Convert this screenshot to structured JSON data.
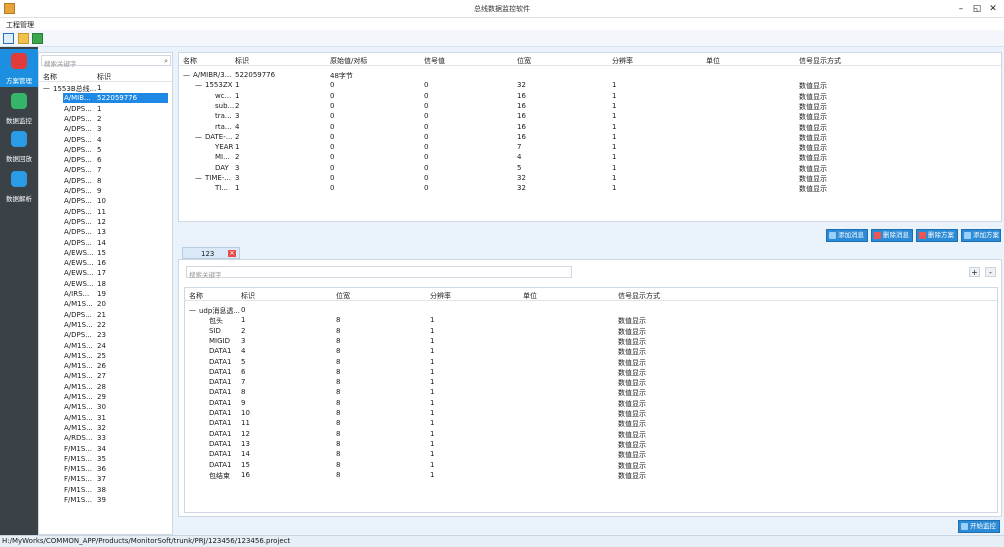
{
  "window": {
    "title": "总线数据监控软件",
    "min": "–",
    "restore": "◱",
    "close": "✕"
  },
  "menu": {
    "project": "工程管理"
  },
  "toolbar": {
    "icons": [
      "new-icon",
      "open-icon",
      "save-icon"
    ]
  },
  "nav": [
    {
      "label": "方案管理",
      "icon": "scheme-icon",
      "color": "#e23b3b"
    },
    {
      "label": "数据监控",
      "icon": "shield-icon",
      "color": "#35b56a"
    },
    {
      "label": "数据回放",
      "icon": "cloud-icon",
      "color": "#2a9be6"
    },
    {
      "label": "数据解析",
      "icon": "board-icon",
      "color": "#2a9be6"
    }
  ],
  "tree": {
    "search_placeholder": "搜索关键字",
    "col_name": "名称",
    "col_id": "标识",
    "root": {
      "toggle": "—",
      "name": "1553B总线...",
      "id": "1"
    },
    "selected": {
      "name": "A/MIB...",
      "id": "522059776"
    },
    "items": [
      {
        "name": "A/DPS...",
        "id": "1"
      },
      {
        "name": "A/DPS...",
        "id": "2"
      },
      {
        "name": "A/DPS...",
        "id": "3"
      },
      {
        "name": "A/DPS...",
        "id": "4"
      },
      {
        "name": "A/DPS...",
        "id": "5"
      },
      {
        "name": "A/DPS...",
        "id": "6"
      },
      {
        "name": "A/DPS...",
        "id": "7"
      },
      {
        "name": "A/DPS...",
        "id": "8"
      },
      {
        "name": "A/DPS...",
        "id": "9"
      },
      {
        "name": "A/DPS...",
        "id": "10"
      },
      {
        "name": "A/DPS...",
        "id": "11"
      },
      {
        "name": "A/DPS...",
        "id": "12"
      },
      {
        "name": "A/DPS...",
        "id": "13"
      },
      {
        "name": "A/DPS...",
        "id": "14"
      },
      {
        "name": "A/EWS...",
        "id": "15"
      },
      {
        "name": "A/EWS...",
        "id": "16"
      },
      {
        "name": "A/EWS...",
        "id": "17"
      },
      {
        "name": "A/EWS...",
        "id": "18"
      },
      {
        "name": "A/IRS...",
        "id": "19"
      },
      {
        "name": "A/M1S...",
        "id": "20"
      },
      {
        "name": "A/DPS...",
        "id": "21"
      },
      {
        "name": "A/M1S...",
        "id": "22"
      },
      {
        "name": "A/DPS...",
        "id": "23"
      },
      {
        "name": "A/M1S...",
        "id": "24"
      },
      {
        "name": "A/M1S...",
        "id": "25"
      },
      {
        "name": "A/M1S...",
        "id": "26"
      },
      {
        "name": "A/M1S...",
        "id": "27"
      },
      {
        "name": "A/M1S...",
        "id": "28"
      },
      {
        "name": "A/M1S...",
        "id": "29"
      },
      {
        "name": "A/M1S...",
        "id": "30"
      },
      {
        "name": "A/M1S...",
        "id": "31"
      },
      {
        "name": "A/M1S...",
        "id": "32"
      },
      {
        "name": "A/RDS...",
        "id": "33"
      },
      {
        "name": "F/M1S...",
        "id": "34"
      },
      {
        "name": "F/M1S...",
        "id": "35"
      },
      {
        "name": "F/M1S...",
        "id": "36"
      },
      {
        "name": "F/M1S...",
        "id": "37"
      },
      {
        "name": "F/M1S...",
        "id": "38"
      },
      {
        "name": "F/M1S...",
        "id": "39"
      }
    ]
  },
  "top_table": {
    "headers": [
      "名称",
      "标识",
      "原始值/对标",
      "信号值",
      "位宽",
      "分辨率",
      "单位",
      "信号显示方式"
    ],
    "rows": [
      {
        "t": "—",
        "n": "A/MIBR/3...",
        "id": "522059776",
        "raw": "48字节",
        "sig": "",
        "w": "",
        "r": "",
        "u": "",
        "d": "",
        "lvl": 0
      },
      {
        "t": "—",
        "n": "1553ZX",
        "id": "1",
        "raw": "0",
        "sig": "0",
        "w": "32",
        "r": "1",
        "u": "",
        "d": "数值显示",
        "lvl": 1
      },
      {
        "t": "",
        "n": "wc...",
        "id": "1",
        "raw": "0",
        "sig": "0",
        "w": "16",
        "r": "1",
        "u": "",
        "d": "数值显示",
        "lvl": 2
      },
      {
        "t": "",
        "n": "sub...",
        "id": "2",
        "raw": "0",
        "sig": "0",
        "w": "16",
        "r": "1",
        "u": "",
        "d": "数值显示",
        "lvl": 2
      },
      {
        "t": "",
        "n": "tra...",
        "id": "3",
        "raw": "0",
        "sig": "0",
        "w": "16",
        "r": "1",
        "u": "",
        "d": "数值显示",
        "lvl": 2
      },
      {
        "t": "",
        "n": "rta...",
        "id": "4",
        "raw": "0",
        "sig": "0",
        "w": "16",
        "r": "1",
        "u": "",
        "d": "数值显示",
        "lvl": 2
      },
      {
        "t": "—",
        "n": "DATE-...",
        "id": "2",
        "raw": "0",
        "sig": "0",
        "w": "16",
        "r": "1",
        "u": "",
        "d": "数值显示",
        "lvl": 1
      },
      {
        "t": "",
        "n": "YEAR",
        "id": "1",
        "raw": "0",
        "sig": "0",
        "w": "7",
        "r": "1",
        "u": "",
        "d": "数值显示",
        "lvl": 2
      },
      {
        "t": "",
        "n": "MI...",
        "id": "2",
        "raw": "0",
        "sig": "0",
        "w": "4",
        "r": "1",
        "u": "",
        "d": "数值显示",
        "lvl": 2
      },
      {
        "t": "",
        "n": "DAY",
        "id": "3",
        "raw": "0",
        "sig": "0",
        "w": "5",
        "r": "1",
        "u": "",
        "d": "数值显示",
        "lvl": 2
      },
      {
        "t": "—",
        "n": "TIME-...",
        "id": "3",
        "raw": "0",
        "sig": "0",
        "w": "32",
        "r": "1",
        "u": "",
        "d": "数值显示",
        "lvl": 1
      },
      {
        "t": "",
        "n": "TI...",
        "id": "1",
        "raw": "0",
        "sig": "0",
        "w": "32",
        "r": "1",
        "u": "",
        "d": "数值显示",
        "lvl": 2
      }
    ]
  },
  "buttons": {
    "add_msg": "添加消息",
    "del_msg": "删除消息",
    "del_scheme": "删除方案",
    "add_scheme": "添加方案",
    "start": "开始监控"
  },
  "tab": {
    "label": "123",
    "close": "✕"
  },
  "bottom": {
    "search_placeholder": "搜索关键字",
    "plus": "+",
    "minus": "-",
    "headers": [
      "名称",
      "标识",
      "位宽",
      "分辨率",
      "单位",
      "信号显示方式"
    ],
    "rows": [
      {
        "t": "—",
        "n": "udp消息透...",
        "id": "0",
        "w": "",
        "r": "",
        "u": "",
        "d": "",
        "lvl": 0
      },
      {
        "t": "",
        "n": "包头",
        "id": "1",
        "w": "8",
        "r": "1",
        "u": "",
        "d": "数值显示",
        "lvl": 1
      },
      {
        "t": "",
        "n": "SID",
        "id": "2",
        "w": "8",
        "r": "1",
        "u": "",
        "d": "数值显示",
        "lvl": 1
      },
      {
        "t": "",
        "n": "MIGID",
        "id": "3",
        "w": "8",
        "r": "1",
        "u": "",
        "d": "数值显示",
        "lvl": 1
      },
      {
        "t": "",
        "n": "DATA1",
        "id": "4",
        "w": "8",
        "r": "1",
        "u": "",
        "d": "数值显示",
        "lvl": 1
      },
      {
        "t": "",
        "n": "DATA1",
        "id": "5",
        "w": "8",
        "r": "1",
        "u": "",
        "d": "数值显示",
        "lvl": 1
      },
      {
        "t": "",
        "n": "DATA1",
        "id": "6",
        "w": "8",
        "r": "1",
        "u": "",
        "d": "数值显示",
        "lvl": 1
      },
      {
        "t": "",
        "n": "DATA1",
        "id": "7",
        "w": "8",
        "r": "1",
        "u": "",
        "d": "数值显示",
        "lvl": 1
      },
      {
        "t": "",
        "n": "DATA1",
        "id": "8",
        "w": "8",
        "r": "1",
        "u": "",
        "d": "数值显示",
        "lvl": 1
      },
      {
        "t": "",
        "n": "DATA1",
        "id": "9",
        "w": "8",
        "r": "1",
        "u": "",
        "d": "数值显示",
        "lvl": 1
      },
      {
        "t": "",
        "n": "DATA1",
        "id": "10",
        "w": "8",
        "r": "1",
        "u": "",
        "d": "数值显示",
        "lvl": 1
      },
      {
        "t": "",
        "n": "DATA1",
        "id": "11",
        "w": "8",
        "r": "1",
        "u": "",
        "d": "数值显示",
        "lvl": 1
      },
      {
        "t": "",
        "n": "DATA1",
        "id": "12",
        "w": "8",
        "r": "1",
        "u": "",
        "d": "数值显示",
        "lvl": 1
      },
      {
        "t": "",
        "n": "DATA1",
        "id": "13",
        "w": "8",
        "r": "1",
        "u": "",
        "d": "数值显示",
        "lvl": 1
      },
      {
        "t": "",
        "n": "DATA1",
        "id": "14",
        "w": "8",
        "r": "1",
        "u": "",
        "d": "数值显示",
        "lvl": 1
      },
      {
        "t": "",
        "n": "DATA1",
        "id": "15",
        "w": "8",
        "r": "1",
        "u": "",
        "d": "数值显示",
        "lvl": 1
      },
      {
        "t": "",
        "n": "包结束",
        "id": "16",
        "w": "8",
        "r": "1",
        "u": "",
        "d": "数值显示",
        "lvl": 1
      }
    ]
  },
  "status": {
    "path": "H:/MyWorks/COMMON_APP/Products/MonitorSoft/trunk/PRJ/123456/123456.project"
  }
}
